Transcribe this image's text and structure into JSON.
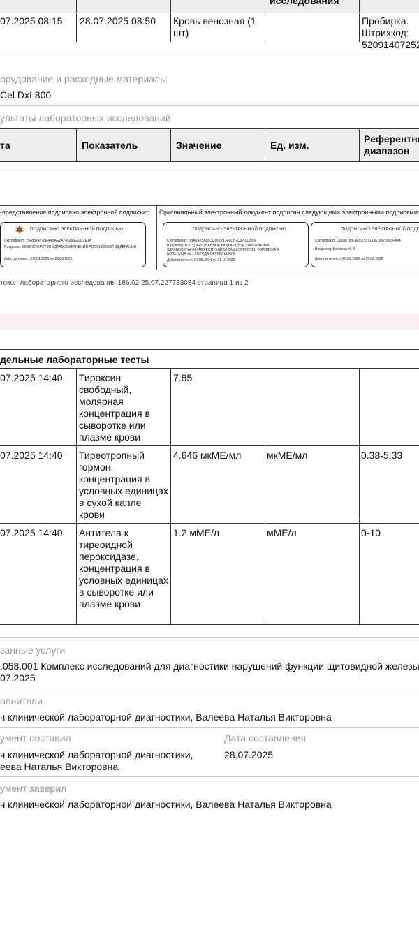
{
  "top_row": {
    "header_partial": "исследования",
    "c1": "07.2025 08:15",
    "c2": "28.07.2025 08:50",
    "c3": "Кровь венозная (1 шт)",
    "c5": "Пробирка. Штрихкод: 52091407252"
  },
  "equipment": {
    "label": "орудование и расходные материалы",
    "value": "Cel DxI 800"
  },
  "results": {
    "label": "ультаты лабораторных исследований",
    "columns": [
      "та",
      "Показатель",
      "Значение",
      "Ед. изм.",
      "Референтный диапазон"
    ]
  },
  "signatures": {
    "left_caption": "-представление подписано электронной подписью:",
    "right_caption": "Оригинальный электронный документ подписан следующими электронными подписями:",
    "stamp_title": "ПОДПИСАНО ЭЛЕКТРОННОЙ ПОДПИСЬЮ",
    "boxes": [
      {
        "cert": "Сертификат: 7548824578E4ABAE2A745296E8322E1A",
        "owner": "Владелец: МИНИСТЕРСТВО ЗДРАВООХРАНЕНИЯ РОССИЙСКОЙ ФЕДЕРАЦИИ",
        "valid": "Действителен: с 02.04.2025 по 26.06.2026"
      },
      {
        "cert": "Сертификат: 6BA0A25A88CDD9371348CB2C97033566",
        "owner": "Владелец: ГОСУДАРСТВЕННОЕ БЮДЖЕТНОЕ УЧРЕЖДЕНИЕ ЗДРАВООХРАНЕНИЯ РЕСПУБЛИКИ БАШКОРТОСТАН ГОРОДСКАЯ БОЛЬНИЦА № 1 ГОРОДА ОКТЯБРЬСКИЙ",
        "valid": "Действителен: с 07.08.2024 по 31.10.2025"
      },
      {
        "cert": "Сертификат: C0280783CA052367133616970993FA94",
        "owner": "Владелец: Валеева Н. В.",
        "valid": "Действителен: с 26.03.2025 по 19.06.2026"
      }
    ]
  },
  "page_footer": "токол лабораторного исследования 186.02.25.07.227733084 страница 1 из 2",
  "tests": {
    "section_title": "дельные лабораторные тесты",
    "rows": [
      {
        "date": "07.2025 14:40",
        "name": "Тироксин свободный, молярная концентрация в сыворотке или плазме крови",
        "value": "7.85",
        "unit": "",
        "ref": ""
      },
      {
        "date": "07.2025 14:40",
        "name": "Тиреотропный гормон, концентрация в условных единицах в сухой капле крови",
        "value": "4.646 мкМЕ/мл",
        "unit": "мкМЕ/мл",
        "ref": "0.38-5.33"
      },
      {
        "date": "07.2025 14:40",
        "name": "Антитела к тиреоидной пероксидазе, концентрация в условных единицах в сыворотке или плазме крови",
        "value": "1.2 мМЕ/л",
        "unit": "мМЕ/л",
        "ref": "0-10"
      }
    ]
  },
  "services": {
    "label": "занные услуги",
    "line1": ".058.001 Комплекс исследований для диагностики нарушений функции щитовидной железы",
    "line2": "07.2025"
  },
  "performers": {
    "label": "олнители",
    "value": "ч клинической лабораторной диагностики, Валеева Наталья Викторовна"
  },
  "composed": {
    "label": "умент составил",
    "value_line1": "ч клинической лабораторной диагностики,",
    "value_line2": "еева Наталья Викторовна",
    "date_label": "Дата составления",
    "date_value": "28.07.2025"
  },
  "certified": {
    "label": "умент заверил",
    "value": "ч клинической лабораторной диагностики, Валеева Наталья Викторовна"
  }
}
